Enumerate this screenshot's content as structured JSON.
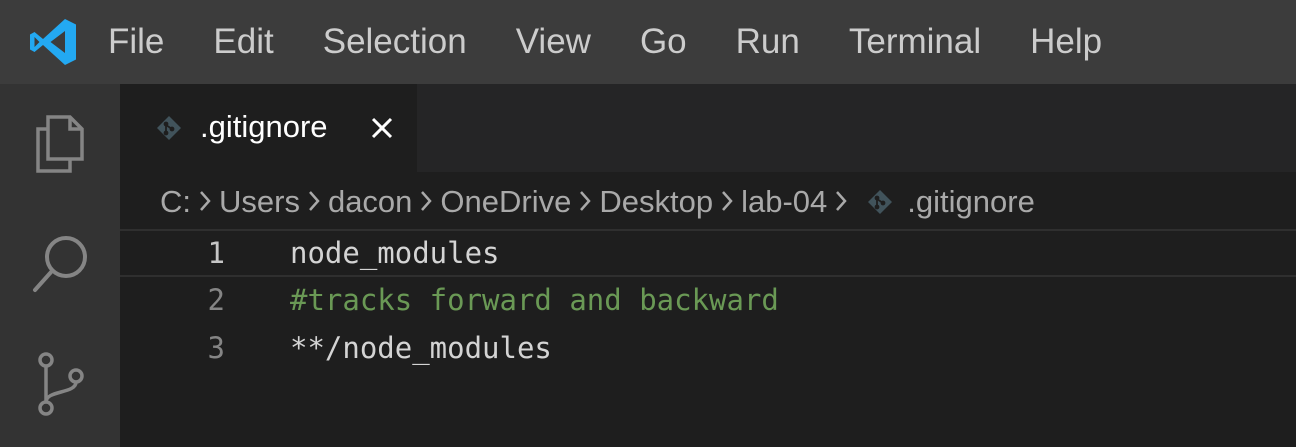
{
  "menu": {
    "items": [
      "File",
      "Edit",
      "Selection",
      "View",
      "Go",
      "Run",
      "Terminal",
      "Help"
    ]
  },
  "activity_bar": {
    "icons": [
      "explorer-icon",
      "search-icon",
      "source-control-icon"
    ]
  },
  "tab": {
    "label": ".gitignore",
    "icon": "git-file-icon",
    "close_icon": "close-icon"
  },
  "breadcrumb": {
    "items": [
      "C:",
      "Users",
      "dacon",
      "OneDrive",
      "Desktop",
      "lab-04",
      ".gitignore"
    ]
  },
  "editor": {
    "lines": [
      {
        "number": "1",
        "text": "node_modules",
        "kind": "plain"
      },
      {
        "number": "2",
        "text": "#tracks forward and backward",
        "kind": "comment"
      },
      {
        "number": "3",
        "text": "**/node_modules",
        "kind": "plain"
      }
    ]
  },
  "colors": {
    "titlebar": "#3c3c3c",
    "activitybar": "#333333",
    "editor_bg": "#1e1e1e",
    "comment": "#6a9955",
    "accent_logo": "#23a9f2"
  }
}
